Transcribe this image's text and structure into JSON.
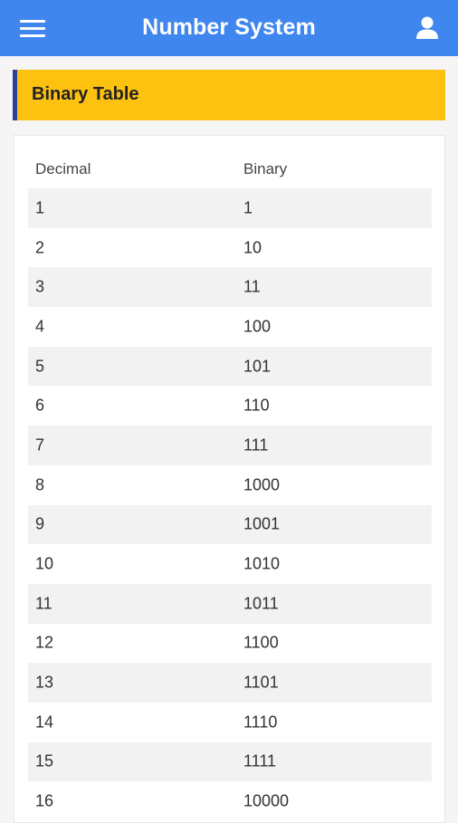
{
  "app_bar": {
    "title": "Number System",
    "menu_icon": "hamburger-menu-icon",
    "user_icon": "user-icon",
    "background": "#3f86ef"
  },
  "section": {
    "title": "Binary Table",
    "background": "#fdc110",
    "accent": "#2f3f9b"
  },
  "table": {
    "headers": {
      "decimal": "Decimal",
      "binary": "Binary"
    },
    "rows": [
      {
        "decimal": "1",
        "binary": "1"
      },
      {
        "decimal": "2",
        "binary": "10"
      },
      {
        "decimal": "3",
        "binary": "11"
      },
      {
        "decimal": "4",
        "binary": "100"
      },
      {
        "decimal": "5",
        "binary": "101"
      },
      {
        "decimal": "6",
        "binary": "110"
      },
      {
        "decimal": "7",
        "binary": "111"
      },
      {
        "decimal": "8",
        "binary": "1000"
      },
      {
        "decimal": "9",
        "binary": "1001"
      },
      {
        "decimal": "10",
        "binary": "1010"
      },
      {
        "decimal": "11",
        "binary": "1011"
      },
      {
        "decimal": "12",
        "binary": "1100"
      },
      {
        "decimal": "13",
        "binary": "1101"
      },
      {
        "decimal": "14",
        "binary": "1110"
      },
      {
        "decimal": "15",
        "binary": "1111"
      },
      {
        "decimal": "16",
        "binary": "10000"
      }
    ]
  }
}
